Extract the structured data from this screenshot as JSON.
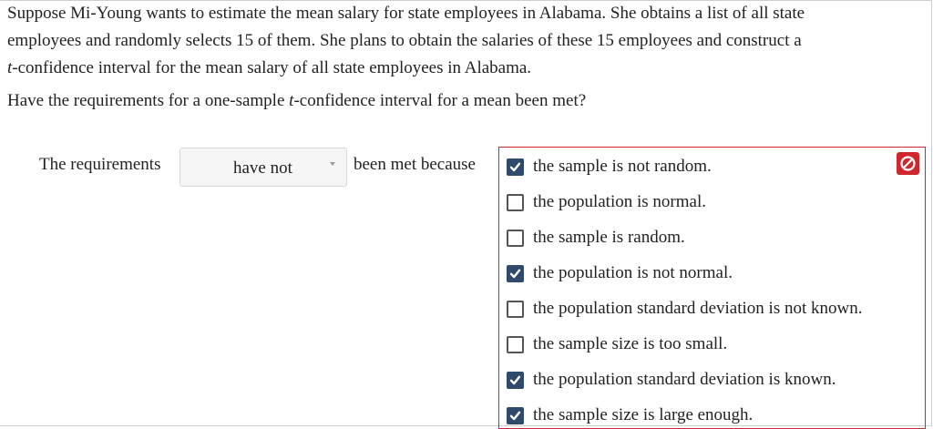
{
  "question": {
    "line1": "Suppose Mi-Young wants to estimate the mean salary for state employees in Alabama. She obtains a list of all state",
    "line2": "employees and randomly selects 15 of them. She plans to obtain the salaries of these 15 employees and construct a",
    "line3_italic": "t",
    "line3_rest": "-confidence interval for the mean salary of all state employees in Alabama.",
    "prompt_a": "Have the requirements for a one-sample ",
    "prompt_t": "t",
    "prompt_b": "-confidence interval for a mean been met?"
  },
  "answer": {
    "label_before": "The requirements",
    "dropdown_value": "have not",
    "label_after": "been met because",
    "error_icon": "no-entry-icon",
    "error_color": "#d0262e",
    "checked_color": "#2f4a6a",
    "choices": [
      {
        "label": "the sample is not random.",
        "checked": true
      },
      {
        "label": "the population is normal.",
        "checked": false
      },
      {
        "label": "the sample is random.",
        "checked": false
      },
      {
        "label": "the population is not normal.",
        "checked": true
      },
      {
        "label": "the population standard deviation is not known.",
        "checked": false
      },
      {
        "label": "the sample size is too small.",
        "checked": false
      },
      {
        "label": "the population standard deviation is known.",
        "checked": true
      },
      {
        "label": "the sample size is large enough.",
        "checked": true
      }
    ]
  }
}
